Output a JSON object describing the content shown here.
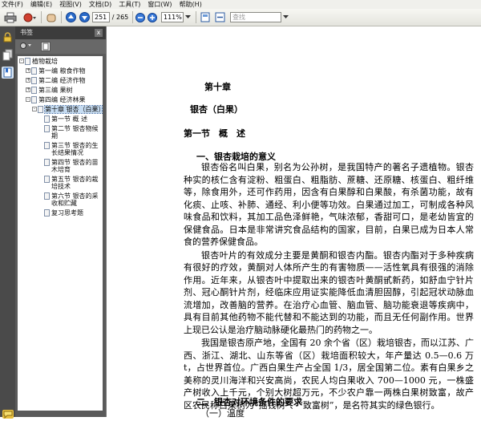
{
  "menu": [
    "文件(F)",
    "编辑(E)",
    "视图(V)",
    "文档(D)",
    "工具(T)",
    "窗口(W)",
    "帮助(H)"
  ],
  "toolbar": {
    "page_current": "251",
    "page_total": "/ 265",
    "zoom": "111%",
    "search_placeholder": "查找"
  },
  "panel": {
    "title": "书签",
    "close": "x",
    "options_label": "选项"
  },
  "bookmarks": [
    {
      "label": "植物栽培",
      "level": 0,
      "toggle": "-"
    },
    {
      "label": "第一编 粮食作物",
      "level": 1,
      "toggle": "+"
    },
    {
      "label": "第二编 经济作物",
      "level": 1,
      "toggle": "+"
    },
    {
      "label": "第三编 果树",
      "level": 1,
      "toggle": "+"
    },
    {
      "label": "第四编 经济林果",
      "level": 1,
      "toggle": "-"
    },
    {
      "label": "第十章 银杏（白果）",
      "level": 2,
      "toggle": "-",
      "selected": true
    },
    {
      "label": "第一节 概 述",
      "level": 3,
      "toggle": ""
    },
    {
      "label": "第二节 银杏物候期",
      "level": 3,
      "toggle": ""
    },
    {
      "label": "第三节 银杏的生长结果情况",
      "level": 3,
      "toggle": ""
    },
    {
      "label": "第四节 银杏的苗木培育",
      "level": 3,
      "toggle": ""
    },
    {
      "label": "第五节 银杏的栽培技术",
      "level": 3,
      "toggle": ""
    },
    {
      "label": "第六节 银杏的采收和贮藏",
      "level": 3,
      "toggle": ""
    },
    {
      "label": "复习思考题",
      "level": 3,
      "toggle": ""
    }
  ],
  "document": {
    "chapter": "第十章",
    "chapter_title": "银杏（白果）",
    "section": "第一节　概　述",
    "heading1": "一、银杏栽培的意义",
    "para1": "银杏俗名叫白果，别名为公孙树，是我国特产的著名子遗植物。银杏种实的核仁含有淀粉、粗蛋白、粗脂肪、蔗糖、还原糖、核蛋白、粗纤维等，除食用外，还可作药用，因含有白果醇和白果酸，有杀菌功能，故有化痰、止咳、补肺、通经、利小便等功效。白果通过加工，可制成各种风味食品和饮料，其加工品色泽鲜艳，气味浓郁，香甜可口，是老幼皆宜的保健食品。日本是非常讲究食品结构的国家，目前，白果已成为日本人常食的营养保健食品。",
    "para2": "银杏叶片的有效成分主要是黄酮和银杏内酯。银杏内酯对于多种疾病有很好的疗效，黄酮对人体所产生的有害物质——活性氧具有很强的消除作用。近年来，从银杏叶中提取出来的银杏叶黄酮甙新药，如舒血宁针片剂、冠心酮针片剂，经临床应用证实能降低血清胆固醇，引起冠状动脉血流增加，改善脑的营养。在治疗心血管、脑血管、脑功能衰退等疾病中，具有目前其他药物不能代替和不能达到的功能，而且无任何副作用。世界上现已公认是治疗脑动脉硬化最热门的药物之一。",
    "para3": "我国是银杏原产地，全国有 20 余个省（区）栽培银杏，而以江苏、广西、浙江、湖北、山东等省（区）栽培面积较大，年产量达 0.5—0.6 万 t，占世界首位。广西白果生产占全国 1/3，居全国第二位。素有白果乡之美称的灵川海洋和兴安高尚，农民人均白果收入 700—1000 元，一株盛产树收入上千元，个别大树超万元，不少农户靠一两株白果树致富，故产区农民称白果树为“摇钱树”、“致富树”，是名符其实的绿色银行。",
    "heading2": "二、银杏对环境条件的要求",
    "heading3": "（一）温度"
  }
}
